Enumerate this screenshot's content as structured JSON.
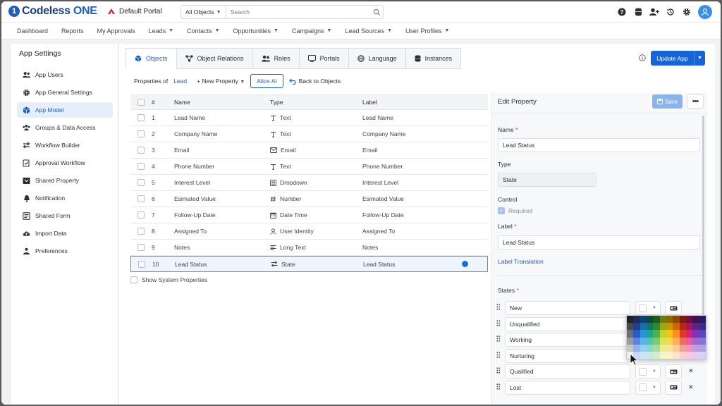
{
  "app": {
    "logo_mark": "1",
    "logo_text": "Codeless",
    "logo_text_bold": " ONE",
    "portal": "Default Portal"
  },
  "search": {
    "scope": "All Objects",
    "placeholder": "Search"
  },
  "nav": [
    "Dashboard",
    "Reports",
    "My Approvals",
    "Leads",
    "Contacts",
    "Opportunities",
    "Campaigns",
    "Lead Sources",
    "User Profiles"
  ],
  "nav_dropdown": [
    false,
    false,
    false,
    true,
    true,
    true,
    true,
    true,
    true
  ],
  "sidebar": {
    "title": "App Settings",
    "items": [
      {
        "label": "App Users",
        "icon": "users-icon"
      },
      {
        "label": "App General Settings",
        "icon": "gear-icon"
      },
      {
        "label": "App Model",
        "icon": "cube-icon",
        "active": true
      },
      {
        "label": "Groups & Data Access",
        "icon": "groups-icon"
      },
      {
        "label": "Workflow Builder",
        "icon": "workflow-icon"
      },
      {
        "label": "Approval Workflow",
        "icon": "approval-icon"
      },
      {
        "label": "Shared Property",
        "icon": "shared-property-icon"
      },
      {
        "label": "Notification",
        "icon": "bell-icon"
      },
      {
        "label": "Shared Form",
        "icon": "form-icon"
      },
      {
        "label": "Import Data",
        "icon": "cloud-upload-icon"
      },
      {
        "label": "Preferences",
        "icon": "preferences-icon"
      }
    ]
  },
  "tabs": [
    "Objects",
    "Object Relations",
    "Roles",
    "Portals",
    "Language",
    "Instances"
  ],
  "update_button": "Update App",
  "subbar": {
    "properties_of": "Properties of",
    "object": "Lead",
    "new_property": "+ New Property",
    "alice": "Alice AI",
    "back": "Back to Objects"
  },
  "table": {
    "headers": {
      "num": "#",
      "name": "Name",
      "type": "Type",
      "label": "Label"
    },
    "rows": [
      {
        "num": "1",
        "name": "Lead Name",
        "type": "Text",
        "type_icon": "text-icon",
        "label": "Lead Name"
      },
      {
        "num": "2",
        "name": "Company Name",
        "type": "Text",
        "type_icon": "text-icon",
        "label": "Company Name"
      },
      {
        "num": "3",
        "name": "Email",
        "type": "Email",
        "type_icon": "email-icon",
        "label": "Email"
      },
      {
        "num": "4",
        "name": "Phone Number",
        "type": "Text",
        "type_icon": "text-icon",
        "label": "Phone Number"
      },
      {
        "num": "5",
        "name": "Interest Level",
        "type": "Dropdown",
        "type_icon": "dropdown-icon",
        "label": "Interest Level"
      },
      {
        "num": "6",
        "name": "Esimated Value",
        "type": "Number",
        "type_icon": "number-icon",
        "label": "Esimated Value"
      },
      {
        "num": "7",
        "name": "Follow-Up Date",
        "type": "Date Time",
        "type_icon": "calendar-icon",
        "label": "Follow-Up Date"
      },
      {
        "num": "8",
        "name": "Assigned To",
        "type": "User Identity",
        "type_icon": "user-icon",
        "label": "Assigned To"
      },
      {
        "num": "9",
        "name": "Notes",
        "type": "Long Text",
        "type_icon": "long-text-icon",
        "label": "Notes"
      },
      {
        "num": "10",
        "name": "Lead Status",
        "type": "State",
        "type_icon": "state-icon",
        "label": "Lead Status",
        "selected": true
      }
    ]
  },
  "show_system": "Show System Properties",
  "edit": {
    "title": "Edit Property",
    "save": "Save",
    "name_label": "Name",
    "name_value": "Lead Status",
    "type_label": "Type",
    "type_value": "State",
    "control_label": "Control",
    "required_label": "Required",
    "label_label": "Label",
    "label_value": "Lead Status",
    "translation_link": "Label Translation",
    "states_label": "States",
    "states": [
      "New",
      "Unqualified",
      "Working",
      "Nurturing",
      "Qualified",
      "Lost"
    ]
  },
  "palette": [
    [
      "#222222",
      "#1f2a55",
      "#14406e",
      "#0b4a3c",
      "#1e5b1e",
      "#6f7a12",
      "#8a6a00",
      "#8a4a00",
      "#7a1c12",
      "#6e0f3a",
      "#3c1454",
      "#2a1a5e"
    ],
    [
      "#4a4a4a",
      "#1f3f8c",
      "#1b6fa8",
      "#14756a",
      "#2e8a2e",
      "#9aa51a",
      "#c99a00",
      "#c96a00",
      "#b8281a",
      "#a8145a",
      "#5e2288",
      "#3c2a8c"
    ],
    [
      "#6e6e6e",
      "#2d5bc4",
      "#2a94d6",
      "#1ea596",
      "#4cb34c",
      "#c4d12a",
      "#f5c21a",
      "#f5941a",
      "#e23a28",
      "#d81f7a",
      "#8234b8",
      "#5a44c0"
    ],
    [
      "#9a9a9a",
      "#5a86de",
      "#5cb2e6",
      "#52c4b4",
      "#7ccb6e",
      "#d8e35a",
      "#f8d65a",
      "#f8b05a",
      "#ec6e5e",
      "#e65c9c",
      "#a466cc",
      "#8474d4"
    ],
    [
      "#c6c6c6",
      "#93b1ea",
      "#94cdf0",
      "#8ad8cc",
      "#a8dca0",
      "#e6ee94",
      "#fae496",
      "#facc94",
      "#f4a296",
      "#f094be",
      "#c49ade",
      "#aea4e4"
    ],
    [
      "#ededed",
      "#c9d8f5",
      "#c9e6f8",
      "#c4ece6",
      "#d3eecd",
      "#f2f6c9",
      "#fdf1ca",
      "#fde5c9",
      "#f9d0ca",
      "#f7c9de",
      "#e1cdee",
      "#d6d1f2"
    ]
  ]
}
